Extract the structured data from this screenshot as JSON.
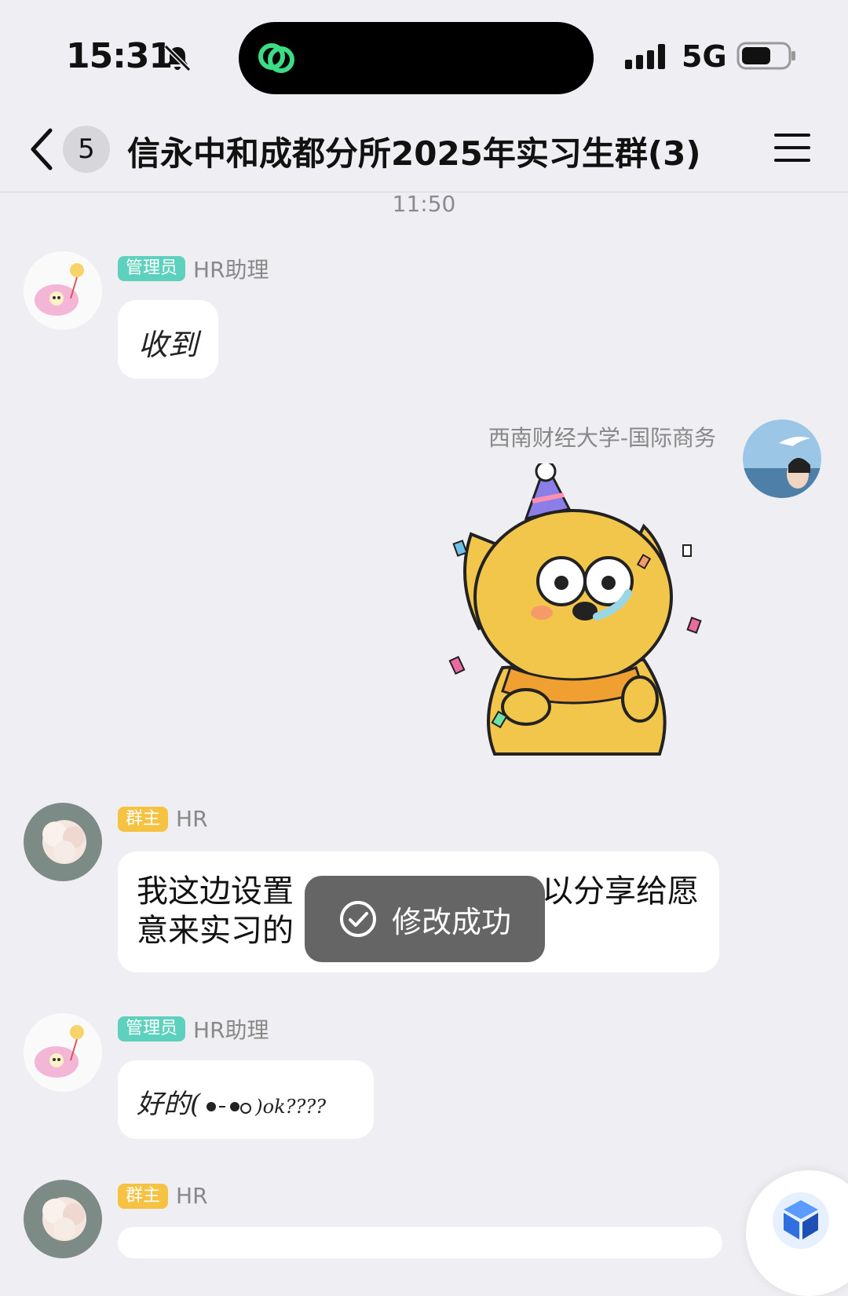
{
  "status": {
    "time": "15:31",
    "network": "5G"
  },
  "nav": {
    "unread_count": "5",
    "title": "信永中和成都分所2025年实习生群(3)"
  },
  "timestamp": "11:50",
  "messages": [
    {
      "role_badge": "管理员",
      "sender": "HR助理",
      "text": "收到"
    },
    {
      "sender": "西南财经大学-国际商务",
      "sticker": "dog-party-sticker"
    },
    {
      "role_badge": "群主",
      "sender": "HR",
      "text_line1_left": "我这边设置",
      "text_line1_right": "以分享给愿",
      "text_line2_left": "意来实习的"
    },
    {
      "role_badge": "管理员",
      "sender": "HR助理",
      "text": "好的(",
      "text_tail": ")ok????"
    },
    {
      "role_badge": "群主",
      "sender": "HR"
    }
  ],
  "toast": {
    "text": "修改成功"
  },
  "colors": {
    "admin_badge": "#5ed1be",
    "owner_badge": "#f5c242",
    "background": "#efeff3"
  }
}
